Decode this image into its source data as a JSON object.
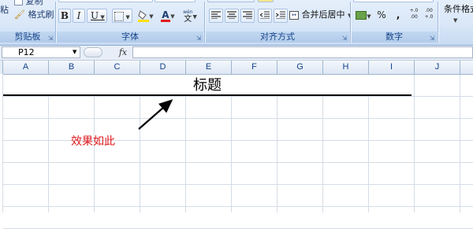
{
  "ribbon": {
    "clipboard": {
      "label": "剪贴板",
      "paste_label": "粘",
      "copy_label": "复制",
      "format_painter_label": "格式刷"
    },
    "font": {
      "label": "字体",
      "bold": "B",
      "italic": "I",
      "underline": "U",
      "font_color_glyph": "A",
      "phonetic_glyph": "wén",
      "phonetic_char": "文"
    },
    "alignment": {
      "label": "对齐方式",
      "merge_center_label": "合并后居中"
    },
    "number": {
      "label": "数字",
      "percent": "%",
      "comma": ",",
      "inc_decimal": "+.0 .00",
      "dec_decimal": ".00 +.0"
    },
    "styles": {
      "conditional_format_label": "条件格式"
    }
  },
  "formula_bar": {
    "name_box_value": "P12",
    "fx_label": "fx",
    "formula_value": ""
  },
  "sheet": {
    "columns": [
      "A",
      "B",
      "C",
      "D",
      "E",
      "F",
      "G",
      "H",
      "I",
      "J"
    ],
    "title_text": "标题",
    "note_text": "效果如此"
  },
  "colors": {
    "note": "#e0191c",
    "font_color_bar": "#e21a1a",
    "fill_color_bar": "#ffe000",
    "header_text": "#15428b"
  }
}
